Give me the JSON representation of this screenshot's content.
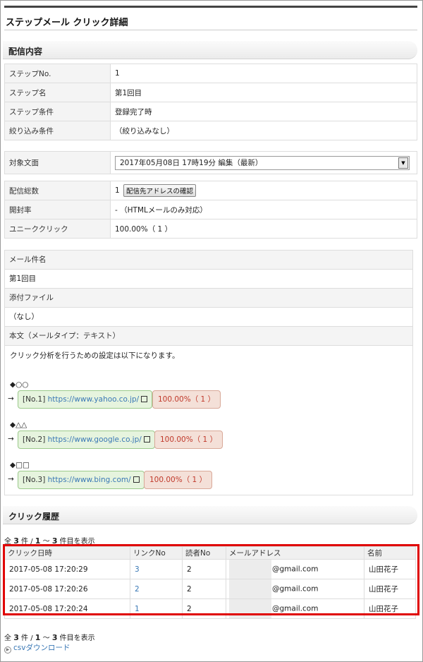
{
  "page": {
    "title": "ステップメール クリック詳細"
  },
  "delivery": {
    "heading": "配信内容",
    "rows": [
      {
        "key": "ステップNo.",
        "value": "1"
      },
      {
        "key": "ステップ名",
        "value": "第1回目"
      },
      {
        "key": "ステップ条件",
        "value": "登録完了時"
      },
      {
        "key": "絞り込み条件",
        "value": "（絞り込みなし）"
      }
    ],
    "target_text_label": "対象文面",
    "target_text_value": "2017年05月08日 17時19分 編集（最新）",
    "stats": {
      "total_label": "配信総数",
      "total_value": "1",
      "confirm_button": "配信先アドレスの確認",
      "open_label": "開封率",
      "open_value": "-",
      "open_note": "（HTMLメールのみ対応）",
      "unique_label": "ユニーククリック",
      "unique_value": "100.00%（ 1 ）"
    }
  },
  "mail": {
    "subject_label": "メール件名",
    "subject_value": "第1回目",
    "attach_label": "添付ファイル",
    "attach_value": "（なし）",
    "body_label": "本文（メールタイプ：テキスト）",
    "body_intro": "クリック分析を行うための設定は以下になります。",
    "links": [
      {
        "symbol": "◆○○",
        "arrow": "→",
        "num": "[No.1]",
        "url": "https://www.yahoo.co.jp/",
        "rate": "100.00%（ 1 ）"
      },
      {
        "symbol": "◆△△",
        "arrow": "→",
        "num": "[No.2]",
        "url": "https://www.google.co.jp/",
        "rate": "100.00%（ 1 ）"
      },
      {
        "symbol": "◆□□",
        "arrow": "→",
        "num": "[No.3]",
        "url": "https://www.bing.com/",
        "rate": "100.00%（ 1 ）"
      }
    ]
  },
  "history": {
    "heading": "クリック履歴",
    "count": {
      "pre": "全",
      "total": "3",
      "mid": "件 /",
      "from": "1",
      "sep": "～",
      "to": "3",
      "post": "件目を表示"
    },
    "columns": [
      "クリック日時",
      "リンクNo",
      "読者No",
      "メールアドレス",
      "名前"
    ],
    "rows": [
      {
        "datetime": "2017-05-08 17:20:29",
        "link_no": "3",
        "reader_no": "2",
        "email": "@gmail.com",
        "name": "山田花子"
      },
      {
        "datetime": "2017-05-08 17:20:26",
        "link_no": "2",
        "reader_no": "2",
        "email": "@gmail.com",
        "name": "山田花子"
      },
      {
        "datetime": "2017-05-08 17:20:24",
        "link_no": "1",
        "reader_no": "2",
        "email": "@gmail.com",
        "name": "山田花子"
      }
    ],
    "csv_link": "csvダウンロード"
  }
}
